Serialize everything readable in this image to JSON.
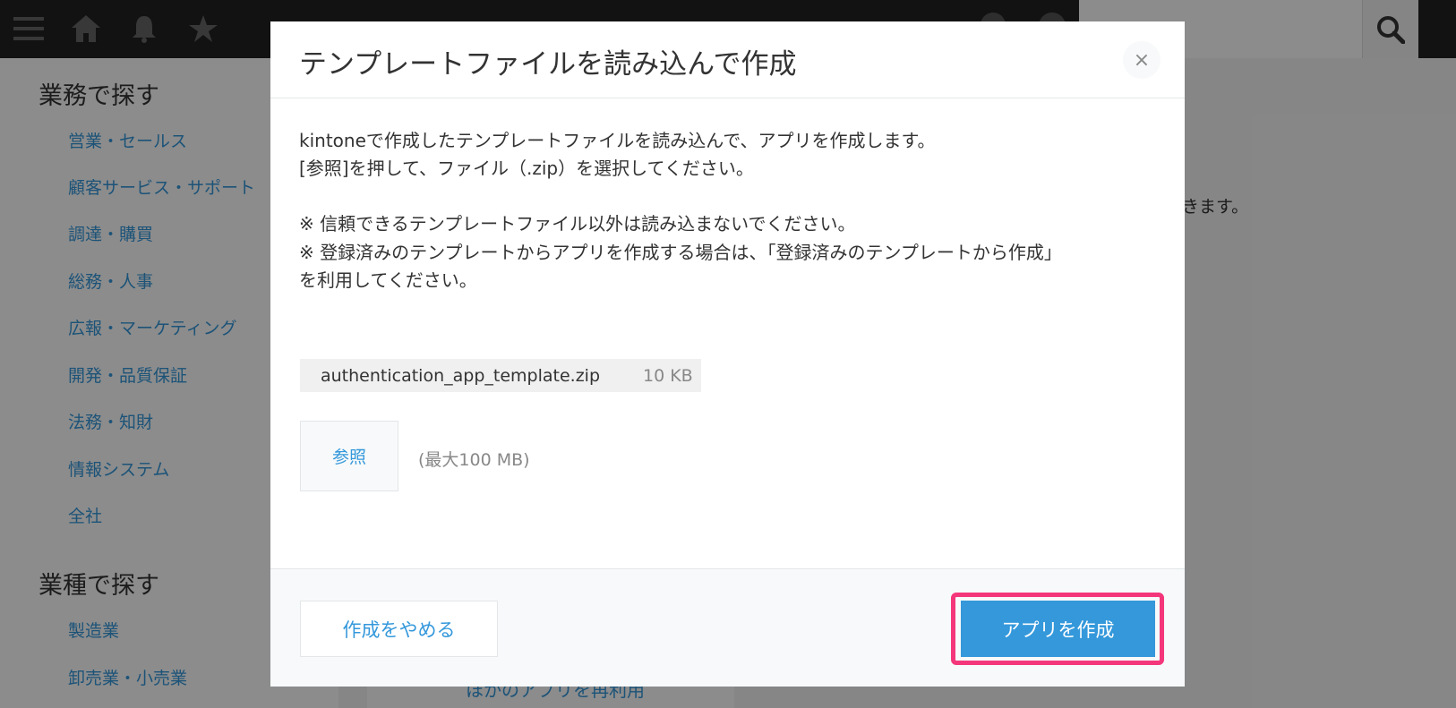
{
  "header": {
    "search_placeholder": "検索"
  },
  "sidebar": {
    "heading_business": "業務で探す",
    "business_items": [
      "営業・セールス",
      "顧客サービス・サポート",
      "調達・購買",
      "総務・人事",
      "広報・マーケティング",
      "開発・品質保証",
      "法務・知財",
      "情報システム",
      "全社"
    ],
    "heading_industry": "業種で探す",
    "industry_items": [
      "製造業",
      "卸売業・小売業"
    ]
  },
  "main": {
    "partial_text": "きます。",
    "partial_card_text": "ほかのアプリを再利用"
  },
  "modal": {
    "title": "テンプレートファイルを読み込んで作成",
    "close_label": "×",
    "desc_line1": "kintoneで作成したテンプレートファイルを読み込んで、アプリを作成します。",
    "desc_line2": "[参照]を押して、ファイル（.zip）を選択してください。",
    "note_line1": "※ 信頼できるテンプレートファイル以外は読み込まないでください。",
    "note_line2": "※ 登録済みのテンプレートからアプリを作成する場合は、「登録済みのテンプレートから作成」",
    "note_line3": "を利用してください。",
    "file_name": "authentication_app_template.zip",
    "file_size": "10 KB",
    "browse_label": "参照",
    "max_size": "(最大100 MB)",
    "cancel_label": "作成をやめる",
    "create_label": "アプリを作成"
  },
  "colors": {
    "accent": "#3498db",
    "highlight": "#f4377a",
    "topbar": "#222222"
  }
}
